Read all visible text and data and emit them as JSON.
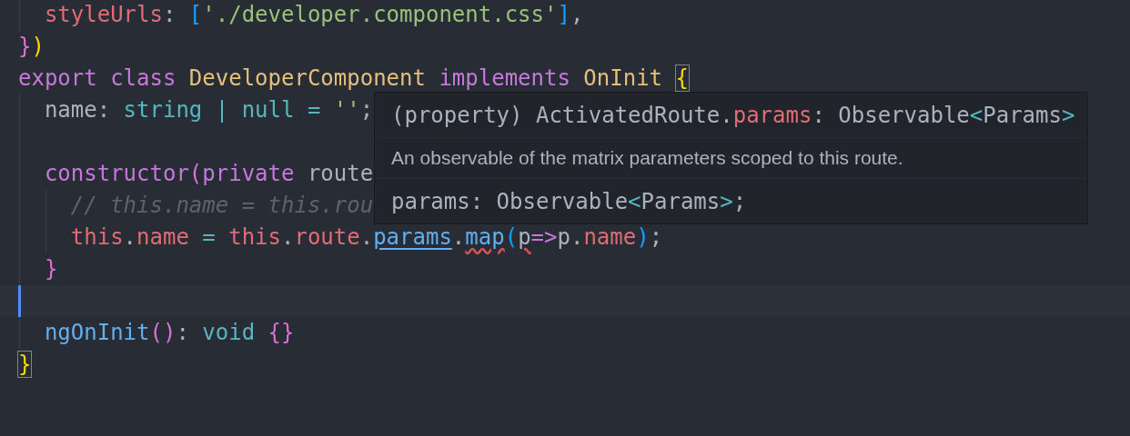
{
  "editor": {
    "lines": [
      {
        "current": false,
        "tokens": [
          {
            "text": "  styleUrls",
            "kind": "property"
          },
          {
            "text": ": "
          },
          {
            "text": "[",
            "kind": "bracket3"
          },
          {
            "text": "'./developer.component.css'",
            "kind": "string"
          },
          {
            "text": "]",
            "kind": "bracket3"
          },
          {
            "text": ","
          }
        ]
      },
      {
        "current": false,
        "tokens": [
          {
            "text": "}",
            "kind": "bracket2"
          },
          {
            "text": ")",
            "kind": "bracket1"
          }
        ]
      },
      {
        "current": false,
        "tokens": [
          {
            "text": "export",
            "kind": "keyword"
          },
          {
            "text": " class",
            "kind": "keyword"
          },
          {
            "text": " DeveloperComponent",
            "kind": "class"
          },
          {
            "text": " implements",
            "kind": "keyword"
          },
          {
            "text": " OnInit ",
            "kind": "class"
          },
          {
            "text": "{",
            "kind": "bracket1",
            "matched": true
          }
        ]
      },
      {
        "current": false,
        "tokens": [
          {
            "text": "  name"
          },
          {
            "text": ": "
          },
          {
            "text": "string",
            "kind": "type"
          },
          {
            "text": " | ",
            "kind": "type"
          },
          {
            "text": "null",
            "kind": "type"
          },
          {
            "text": " = ",
            "kind": "type"
          },
          {
            "text": "''",
            "kind": "string"
          },
          {
            "text": ";"
          }
        ]
      },
      {
        "current": false
      },
      {
        "current": false,
        "tokens": [
          {
            "text": "  constructor",
            "kind": "keyword"
          },
          {
            "text": "(",
            "kind": "bracket2"
          },
          {
            "text": "private",
            "kind": "keyword"
          },
          {
            "text": " route"
          }
        ]
      },
      {
        "current": false,
        "tokens": [
          {
            "text": "    // this.name = this.rou",
            "kind": "comment"
          }
        ]
      },
      {
        "current": false,
        "tokens": [
          {
            "text": "    this",
            "kind": "property"
          },
          {
            "text": "."
          },
          {
            "text": "name",
            "kind": "property"
          },
          {
            "text": " = ",
            "kind": "type"
          },
          {
            "text": "this",
            "kind": "property"
          },
          {
            "text": "."
          },
          {
            "text": "route",
            "kind": "property"
          },
          {
            "text": "."
          },
          {
            "text": "params",
            "kind": "function",
            "link": true
          },
          {
            "text": "."
          },
          {
            "text": "map",
            "kind": "function",
            "error": true
          },
          {
            "text": "(",
            "kind": "bracket3"
          },
          {
            "text": "p",
            "error": true
          },
          {
            "text": "=>",
            "kind": "keyword"
          },
          {
            "text": "p"
          },
          {
            "text": "."
          },
          {
            "text": "name",
            "kind": "property"
          },
          {
            "text": ")",
            "kind": "bracket3"
          },
          {
            "text": ";"
          }
        ]
      },
      {
        "current": false,
        "tokens": [
          {
            "text": "  }",
            "kind": "bracket2"
          }
        ]
      },
      {
        "current": true
      },
      {
        "current": false,
        "tokens": [
          {
            "text": "  ngOnInit",
            "kind": "function"
          },
          {
            "text": "()",
            "kind": "bracket2"
          },
          {
            "text": ": "
          },
          {
            "text": "void",
            "kind": "type"
          },
          {
            "text": " {}",
            "kind": "bracket2"
          }
        ]
      },
      {
        "current": false,
        "tokens": [
          {
            "text": "}",
            "kind": "bracket1",
            "matched": true
          }
        ]
      }
    ]
  },
  "tooltip": {
    "signature": [
      {
        "text": "(property) ActivatedRoute."
      },
      {
        "text": "params",
        "kind": "property"
      },
      {
        "text": ": Observable"
      },
      {
        "text": "<",
        "kind": "type"
      },
      {
        "text": "Params"
      },
      {
        "text": ">",
        "kind": "type"
      }
    ],
    "description": "An observable of the matrix parameters scoped to this route.",
    "declaration": [
      {
        "text": "params: Observable"
      },
      {
        "text": "<",
        "kind": "type"
      },
      {
        "text": "Params"
      },
      {
        "text": ">",
        "kind": "type"
      },
      {
        "text": ";"
      }
    ]
  }
}
